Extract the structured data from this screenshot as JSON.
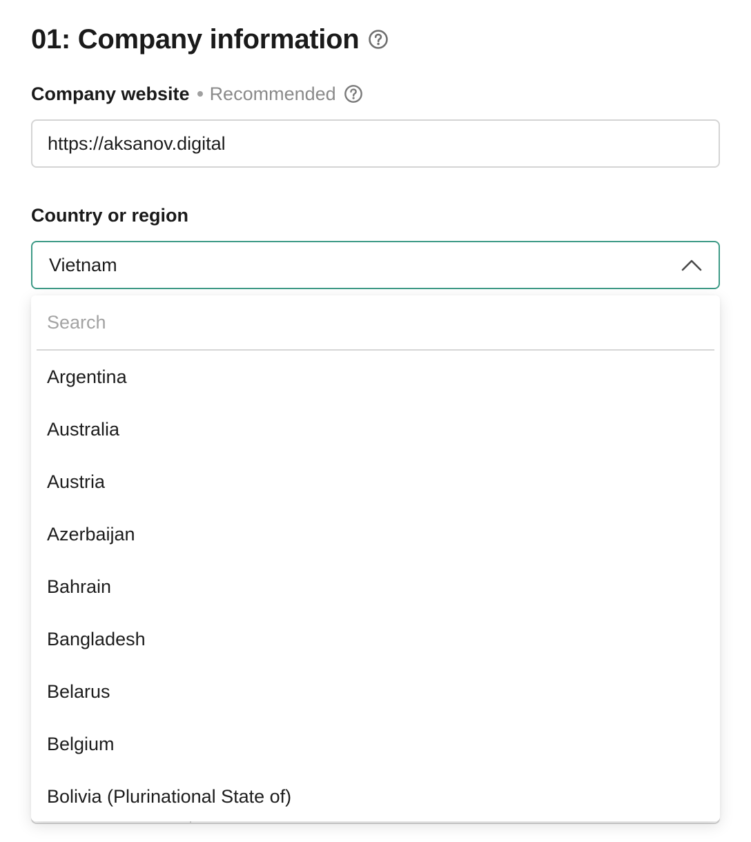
{
  "section": {
    "title": "01: Company information",
    "help_icon": "question-circle-icon"
  },
  "company_website": {
    "label": "Company website",
    "secondary_label": "Recommended",
    "help_icon": "question-circle-icon",
    "value": "https://aksanov.digital"
  },
  "country": {
    "label": "Country or region",
    "selected_value": "Vietnam",
    "toggle_icon": "chevron-up-icon",
    "dropdown": {
      "search_placeholder": "Search",
      "options": [
        "Argentina",
        "Australia",
        "Austria",
        "Azerbaijan",
        "Bahrain",
        "Bangladesh",
        "Belarus",
        "Belgium",
        "Bolivia (Plurinational State of)"
      ]
    }
  },
  "colors": {
    "focus_border": "#3d9a86",
    "input_border": "#d4d4d4",
    "muted_text": "#8a8a8a",
    "placeholder": "#a3a3a3"
  }
}
